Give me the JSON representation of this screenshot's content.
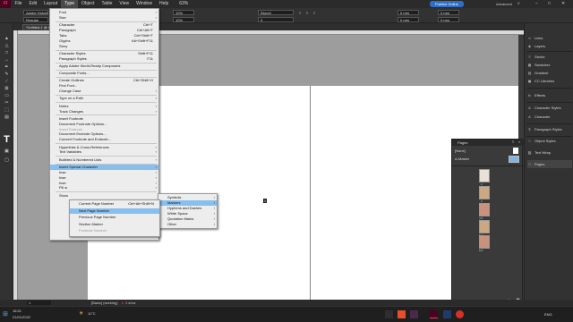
{
  "menubar": {
    "items": [
      "Fl",
      "File",
      "Edit",
      "Layout",
      "Type",
      "Object",
      "Table",
      "View",
      "Window",
      "Help"
    ],
    "zoom": "63%",
    "publish": "Publish Online",
    "workspace": "Advanced",
    "search_icon": "search-icon"
  },
  "controlbar": {
    "font": "Adobe Helvet",
    "style": "Regular",
    "size_a": "10%",
    "size_b": "10%",
    "leading": "[None]",
    "tracking": "0",
    "x_a": "0 mm",
    "x_b": "0 mm",
    "y_a": "0 mm",
    "y_b": "0 mm"
  },
  "tab": {
    "label": "*Untitled-1 @ 63% [Preview]"
  },
  "type_menu": {
    "items": [
      {
        "label": "Font",
        "arrow": true
      },
      {
        "label": "Size",
        "arrow": true
      },
      {
        "sep": true
      },
      {
        "label": "Character",
        "shortcut": "Ctrl+T"
      },
      {
        "label": "Paragraph",
        "shortcut": "Ctrl+Alt+T"
      },
      {
        "label": "Tabs",
        "shortcut": "Ctrl+Shift+T"
      },
      {
        "label": "Glyphs",
        "shortcut": "Alt+Shift+F11"
      },
      {
        "label": "Story"
      },
      {
        "sep": true
      },
      {
        "label": "Character Styles",
        "shortcut": "Shift+F11"
      },
      {
        "label": "Paragraph Styles",
        "shortcut": "F11"
      },
      {
        "sep": true
      },
      {
        "label": "Apply Adobe World-Ready Composers"
      },
      {
        "sep": true
      },
      {
        "label": "Composite Fonts..."
      },
      {
        "sep": true
      },
      {
        "label": "Create Outlines",
        "shortcut": "Ctrl+Shift+O"
      },
      {
        "label": "Find Font..."
      },
      {
        "label": "Change Case",
        "arrow": true
      },
      {
        "sep": true
      },
      {
        "label": "Type on a Path",
        "arrow": true
      },
      {
        "sep": true
      },
      {
        "label": "Notes",
        "arrow": true
      },
      {
        "label": "Track Changes",
        "arrow": true
      },
      {
        "sep": true
      },
      {
        "label": "Insert Footnote"
      },
      {
        "label": "Document Footnote Options..."
      },
      {
        "label": "Insert Endnote",
        "disabled": true
      },
      {
        "label": "Document Endnote Options..."
      },
      {
        "label": "Convert Footnote and Endnote..."
      },
      {
        "sep": true
      },
      {
        "label": "Hyperlinks & Cross-References",
        "arrow": true
      },
      {
        "label": "Text Variables",
        "arrow": true
      },
      {
        "sep": true
      },
      {
        "label": "Bulleted & Numbered Lists",
        "arrow": true
      },
      {
        "sep": true
      },
      {
        "label": "Insert Special Character",
        "arrow": true,
        "highlight": true
      },
      {
        "label": "Inse",
        "arrow": true
      },
      {
        "label": "Inse",
        "arrow": true
      },
      {
        "label": "Inse",
        "arrow": true
      },
      {
        "label": "Fill w",
        "arrow": true
      },
      {
        "sep": true
      },
      {
        "label": "Show"
      }
    ]
  },
  "special_menu": {
    "items": [
      {
        "label": "Symbols",
        "arrow": true
      },
      {
        "label": "Markers",
        "arrow": true,
        "highlight": true
      },
      {
        "label": "Hyphens and Dashes",
        "arrow": true
      },
      {
        "label": "White Space",
        "arrow": true
      },
      {
        "label": "Quotation Marks",
        "arrow": true
      },
      {
        "label": "Other",
        "arrow": true
      }
    ]
  },
  "markers_menu": {
    "items": [
      {
        "label": "Current Page Number",
        "shortcut": "Ctrl+Alt+Shift+N"
      },
      {
        "label": "Next Page Number",
        "highlight": true
      },
      {
        "label": "Previous Page Number"
      },
      {
        "label": "Section Marker"
      },
      {
        "label": "Footnote Number",
        "disabled": true
      }
    ]
  },
  "right_panel": {
    "items": [
      "Links",
      "Layers",
      "Stroke",
      "Swatches",
      "Gradient",
      "CC Libraries",
      "Effects",
      "Character Styles",
      "Character",
      "Paragraph Styles",
      "Object Styles",
      "Text Wrap",
      "Pages"
    ]
  },
  "pages_panel": {
    "title": "Pages",
    "none_label": "[None]",
    "master_label": "A-Master",
    "page_labels": [
      "2",
      "3",
      "4-5",
      "6-7",
      "8-9"
    ],
    "footer": "1 Master"
  },
  "canvas": {
    "page_marker": "1"
  },
  "statusbar": {
    "page": "1",
    "master": "[Basic] (working)",
    "errors": "1 error"
  },
  "taskbar": {
    "time": "18:51",
    "date": "21/01/2022",
    "temp": "11°C",
    "lang": "ENG"
  },
  "colors": {
    "menu_highlight": "#87bfef",
    "publish_button": "#2d6fc6",
    "indesign_pink": "#ff3366"
  }
}
